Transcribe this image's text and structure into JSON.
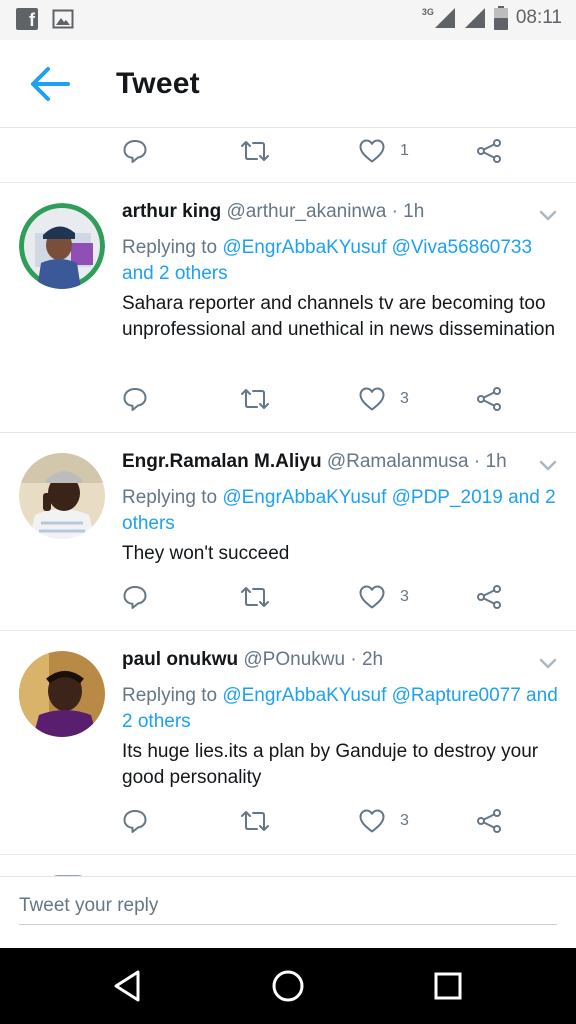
{
  "status_bar": {
    "network": "3G",
    "time": "08:11"
  },
  "header": {
    "title": "Tweet",
    "back_icon": "arrow-left-icon",
    "accent": "#1da1f2"
  },
  "top_actions": {
    "like_count": "1"
  },
  "tweets": [
    {
      "name": "arthur king",
      "handle": "@arthur_akaninwa",
      "time": "· 1h",
      "replying_prefix": "Replying to ",
      "mentions": "@EngrAbbaKYusuf @Viva56860733 and 2 others",
      "text": "Sahara reporter and channels tv are becoming too unprofessional and unethical in news dissemination",
      "like_count": "3"
    },
    {
      "name": "Engr.Ramalan M.Aliyu",
      "handle": "@Ramalanmusa",
      "time": "· 1h",
      "replying_prefix": "Replying to ",
      "mentions": "@EngrAbbaKYusuf @PDP_2019 and 2 others",
      "text": "They won't succeed",
      "like_count": "3"
    },
    {
      "name": "paul onukwu",
      "handle": "@POnukwu",
      "time": "· 2h",
      "replying_prefix": "Replying to ",
      "mentions": "@EngrAbbaKYusuf @Rapture0077 and 2 others",
      "text": "Its huge lies.its a plan by Ganduje to destroy your good personality",
      "like_count": "3"
    }
  ],
  "reply_box": {
    "placeholder": "Tweet your reply"
  },
  "colors": {
    "name": "#14171a",
    "secondary": "#657786",
    "link": "#1da1f2",
    "divider": "#e1e8ed"
  }
}
